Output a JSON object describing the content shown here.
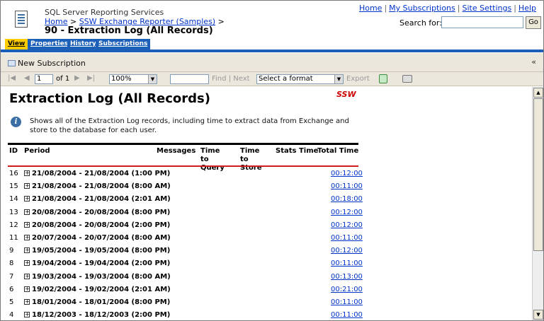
{
  "header": {
    "app_title": "SQL Server Reporting Services",
    "breadcrumb": {
      "home": "Home",
      "sep1": " > ",
      "folder": "SSW Exchange Reporter (Samples)",
      "sep2": " >"
    },
    "page_title": "90 - Extraction Log (All Records)",
    "links": {
      "home": "Home",
      "my_subscriptions": "My Subscriptions",
      "site_settings": "Site Settings",
      "help": "Help",
      "separator": "|"
    },
    "search": {
      "label": "Search for:",
      "value": "",
      "go_label": "Go"
    }
  },
  "tabs": [
    {
      "label": "View",
      "active": true
    },
    {
      "label": "Properties",
      "active": false
    },
    {
      "label": "History",
      "active": false
    },
    {
      "label": "Subscriptions",
      "active": false
    }
  ],
  "subscription_bar": {
    "new_subscription": "New Subscription",
    "collapse_glyph": "«"
  },
  "report_toolbar": {
    "first_glyph": "|◀",
    "prev_glyph": "◀",
    "next_glyph": "▶",
    "last_glyph": "▶|",
    "page_value": "1",
    "of_label": "of 1",
    "zoom": "100%",
    "find_value": "",
    "find_label": "Find",
    "next_label": "Next",
    "separator": "|",
    "format_placeholder": "Select a format",
    "export_label": "Export",
    "dropdown_glyph": "▼"
  },
  "report": {
    "title": "Extraction Log (All Records)",
    "logo_text": "SSW",
    "description": "Shows all of the Extraction Log records, including time to extract data from Exchange and store to the database for each user.",
    "info_glyph": "i",
    "expand_glyph": "+",
    "columns": {
      "id": "ID",
      "period": "Period",
      "messages": "Messages",
      "time_to_query": "Time to Query",
      "time_to_store": "Time to Store",
      "stats_time": "Stats Time",
      "total_time": "Total Time"
    },
    "rows": [
      {
        "id": "16",
        "period": "21/08/2004 - 21/08/2004 (1:00 PM)",
        "total": "00:12:00"
      },
      {
        "id": "15",
        "period": "21/08/2004 - 21/08/2004 (8:00 AM)",
        "total": "00:11:00"
      },
      {
        "id": "14",
        "period": "21/08/2004 - 21/08/2004 (2:01 AM)",
        "total": "00:18:00"
      },
      {
        "id": "13",
        "period": "20/08/2004 - 20/08/2004 (8:00 PM)",
        "total": "00:12:00"
      },
      {
        "id": "12",
        "period": "20/08/2004 - 20/08/2004 (2:00 PM)",
        "total": "00:12:00"
      },
      {
        "id": "11",
        "period": "20/07/2004 - 20/07/2004 (8:00 AM)",
        "total": "00:11:00"
      },
      {
        "id": "9",
        "period": "19/05/2004 - 19/05/2004 (8:00 PM)",
        "total": "00:12:00"
      },
      {
        "id": "8",
        "period": "19/04/2004 - 19/04/2004 (2:00 PM)",
        "total": "00:11:00"
      },
      {
        "id": "7",
        "period": "19/03/2004 - 19/03/2004 (8:00 AM)",
        "total": "00:13:00"
      },
      {
        "id": "6",
        "period": "19/02/2004 - 19/02/2004 (2:01 AM)",
        "total": "00:21:00"
      },
      {
        "id": "5",
        "period": "18/01/2004 - 18/01/2004 (8:00 PM)",
        "total": "00:11:00"
      },
      {
        "id": "4",
        "period": "18/12/2003 - 18/12/2003 (2:00 PM)",
        "total": "00:11:00"
      }
    ]
  },
  "scrollbar": {
    "up_glyph": "▲",
    "down_glyph": "▼"
  },
  "colors": {
    "tab_blue": "#1c5fb8",
    "tab_active": "#ffcc00",
    "link": "#0033cc",
    "table_red": "#d41c1c",
    "toolbar_bg": "#ebe7dc"
  }
}
